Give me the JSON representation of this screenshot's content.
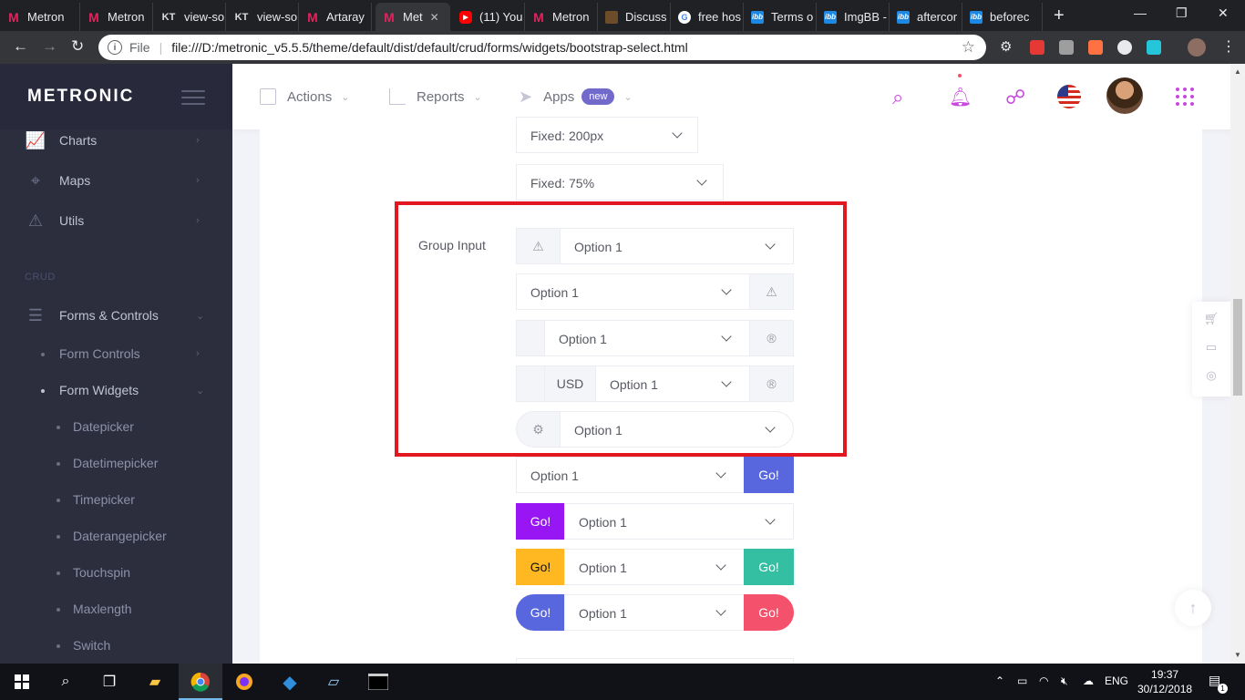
{
  "browser": {
    "tabs": [
      {
        "title": "Metron",
        "icon": "metronic-icon"
      },
      {
        "title": "Metron",
        "icon": "metronic-icon"
      },
      {
        "title": "view-so",
        "icon": "kt-icon"
      },
      {
        "title": "view-so",
        "icon": "kt-icon"
      },
      {
        "title": "Artaray",
        "icon": "metronic-icon"
      },
      {
        "title": "Met",
        "icon": "metronic-icon",
        "active": true
      },
      {
        "title": "(11) You",
        "icon": "youtube-icon"
      },
      {
        "title": "Metron",
        "icon": "metronic-icon"
      },
      {
        "title": "Discuss",
        "icon": "discuss-icon"
      },
      {
        "title": "free hos",
        "icon": "google-icon"
      },
      {
        "title": "Terms o",
        "icon": "ibb-icon"
      },
      {
        "title": "ImgBB -",
        "icon": "ibb-icon"
      },
      {
        "title": "aftercor",
        "icon": "ibb-icon"
      },
      {
        "title": "beforec",
        "icon": "ibb-icon"
      }
    ],
    "address": {
      "scheme_label": "File",
      "url": "file:///D:/metronic_v5.5.5/theme/default/dist/default/crud/forms/widgets/bootstrap-select.html"
    }
  },
  "sidebar": {
    "brand": "METRONIC",
    "top_items": [
      {
        "label": "Charts",
        "icon": "chart-icon"
      },
      {
        "label": "Maps",
        "icon": "map-pin-icon"
      },
      {
        "label": "Utils",
        "icon": "warning-icon"
      }
    ],
    "section": "CRUD",
    "forms": {
      "label": "Forms & Controls",
      "icon": "sliders-icon"
    },
    "sub_items": [
      {
        "label": "Form Controls"
      },
      {
        "label": "Form Widgets"
      }
    ],
    "widget_items": [
      "Datepicker",
      "Datetimepicker",
      "Timepicker",
      "Daterangepicker",
      "Touchspin",
      "Maxlength",
      "Switch"
    ]
  },
  "header": {
    "nav": [
      {
        "label": "Actions",
        "icon": "add-icon"
      },
      {
        "label": "Reports",
        "icon": "chart-icon"
      },
      {
        "label": "Apps",
        "icon": "paper-plane-icon",
        "badge": "new"
      }
    ],
    "icons": [
      "search-icon",
      "bell-icon",
      "share-icon",
      "flag-us-icon",
      "avatar",
      "apps-grid-icon"
    ],
    "accent_color": "#c948e0"
  },
  "content": {
    "fixed_200": "Fixed: 200px",
    "fixed_75": "Fixed: 75%",
    "group_label": "Group Input",
    "option": "Option 1",
    "usd": "USD",
    "go": "Go!",
    "colors": {
      "blue": "#5867dd",
      "purple": "#9816f4",
      "yellow": "#ffb822",
      "green": "#34bfa3",
      "red": "#f4516c"
    }
  },
  "taskbar": {
    "lang": "ENG",
    "time": "19:37",
    "date": "30/12/2018",
    "notifications": "1"
  }
}
